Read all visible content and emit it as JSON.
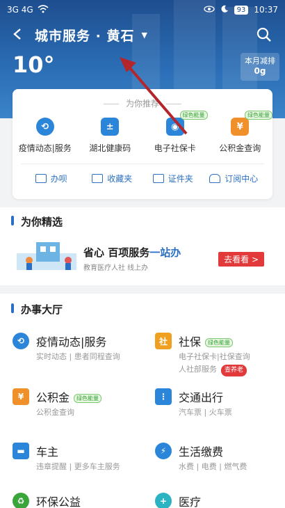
{
  "status": {
    "left": "3G 4G",
    "battery": "93",
    "time": "10:37"
  },
  "header": {
    "title": "城市服务 · 黄石",
    "temperature": "10°",
    "carbon_label": "本月减排",
    "carbon_value": "0g"
  },
  "recommend": {
    "heading": "为你推荐",
    "services": [
      {
        "label": "疫情动态|服务",
        "badge": ""
      },
      {
        "label": "湖北健康码",
        "badge": ""
      },
      {
        "label": "电子社保卡",
        "badge": "绿色能量"
      },
      {
        "label": "公积金查询",
        "badge": "绿色能量"
      }
    ],
    "quick": [
      "办呗",
      "收藏夹",
      "证件夹",
      "订阅中心"
    ]
  },
  "featured": {
    "title": "为你精选",
    "banner_title_a": "省心 百项服务",
    "banner_title_b": "一站办",
    "banner_sub": "教育医疗人社 线上办",
    "banner_button": "去看看 >"
  },
  "hall": {
    "title": "办事大厅",
    "items": [
      {
        "title": "疫情动态|服务",
        "sub": "实时动态 | 患者同程查询",
        "badge": "",
        "sub2": "",
        "red": ""
      },
      {
        "title": "社保",
        "sub": "电子社保卡|社保查询",
        "badge": "绿色能量",
        "sub2": "人社部服务",
        "red": "查养老"
      },
      {
        "title": "公积金",
        "sub": "公积金查询",
        "badge": "绿色能量",
        "sub2": "",
        "red": ""
      },
      {
        "title": "交通出行",
        "sub": "汽车票 | 火车票",
        "badge": "",
        "sub2": "",
        "red": ""
      },
      {
        "title": "车主",
        "sub": "违章提醒 | 更多车主服务",
        "badge": "",
        "sub2": "",
        "red": ""
      },
      {
        "title": "生活缴费",
        "sub": "水费 | 电费 | 燃气费",
        "badge": "",
        "sub2": "",
        "red": ""
      },
      {
        "title": "环保公益",
        "sub": "",
        "badge": "",
        "sub2": "",
        "red": ""
      },
      {
        "title": "医疗",
        "sub": "",
        "badge": "",
        "sub2": "",
        "red": ""
      }
    ]
  },
  "colors": {
    "brand_blue": "#2b6fc4",
    "header_top": "#1e4e8f",
    "red": "#e23a3a",
    "green": "#3aa53a"
  }
}
